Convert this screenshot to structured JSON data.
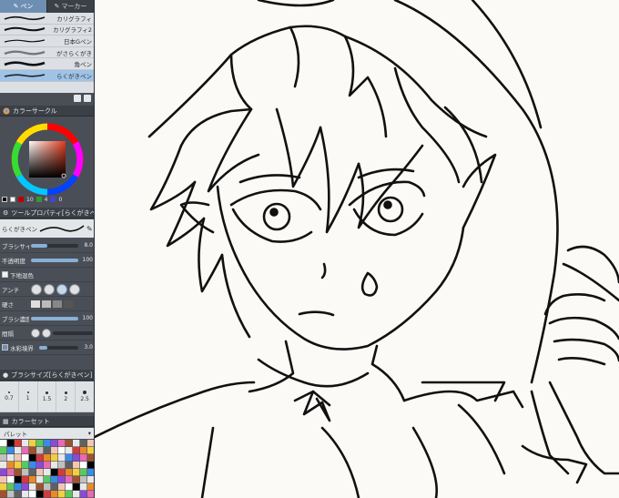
{
  "brush_palette": {
    "tabs": [
      {
        "label": "ペン",
        "active": true
      },
      {
        "label": "マーカー",
        "active": false
      }
    ],
    "brushes": [
      {
        "name": "カリグラフィ",
        "selected": false
      },
      {
        "name": "カリグラフィ2",
        "selected": false
      },
      {
        "name": "日本Gペン",
        "selected": false
      },
      {
        "name": "がさらくがき",
        "selected": false
      },
      {
        "name": "角ペン",
        "selected": false
      },
      {
        "name": "らくがきペン",
        "selected": true
      }
    ]
  },
  "color_circle": {
    "title": "カラーサークル",
    "values": [
      "10",
      "4",
      "0"
    ],
    "main_color": "#000000",
    "sub_color": "#ffffff"
  },
  "tool_property": {
    "title": "ツールプロパティ[らくがきペン]",
    "brush_name": "らくがきペン",
    "rows": [
      {
        "label": "ブラシサイズ",
        "value": "8.0",
        "fill": 0.35
      },
      {
        "label": "不透明度",
        "value": "100",
        "fill": 1.0
      },
      {
        "label": "下地混色",
        "value": "",
        "fill": 0
      },
      {
        "label": "アンチ",
        "value": "",
        "fill": 0
      },
      {
        "label": "硬さ",
        "value": "",
        "fill": 0
      },
      {
        "label": "ブラシ濃度",
        "value": "100",
        "fill": 1.0
      },
      {
        "label": "間隔",
        "value": "",
        "fill": 0
      },
      {
        "label": "水彩境界",
        "value": "3.0",
        "fill": 0.2
      }
    ]
  },
  "brush_size": {
    "title": "ブラシサイズ[らくがきペン]",
    "sizes": [
      "0.7",
      "1",
      "1.5",
      "2",
      "2.5"
    ]
  },
  "color_set": {
    "title": "カラーセット",
    "palette_name": "パレット"
  },
  "colors": {
    "accent": "#6d8fb3",
    "panel_bg": "#4a4f57",
    "canvas_bg": "#fbfaf7",
    "line": "#111111"
  }
}
